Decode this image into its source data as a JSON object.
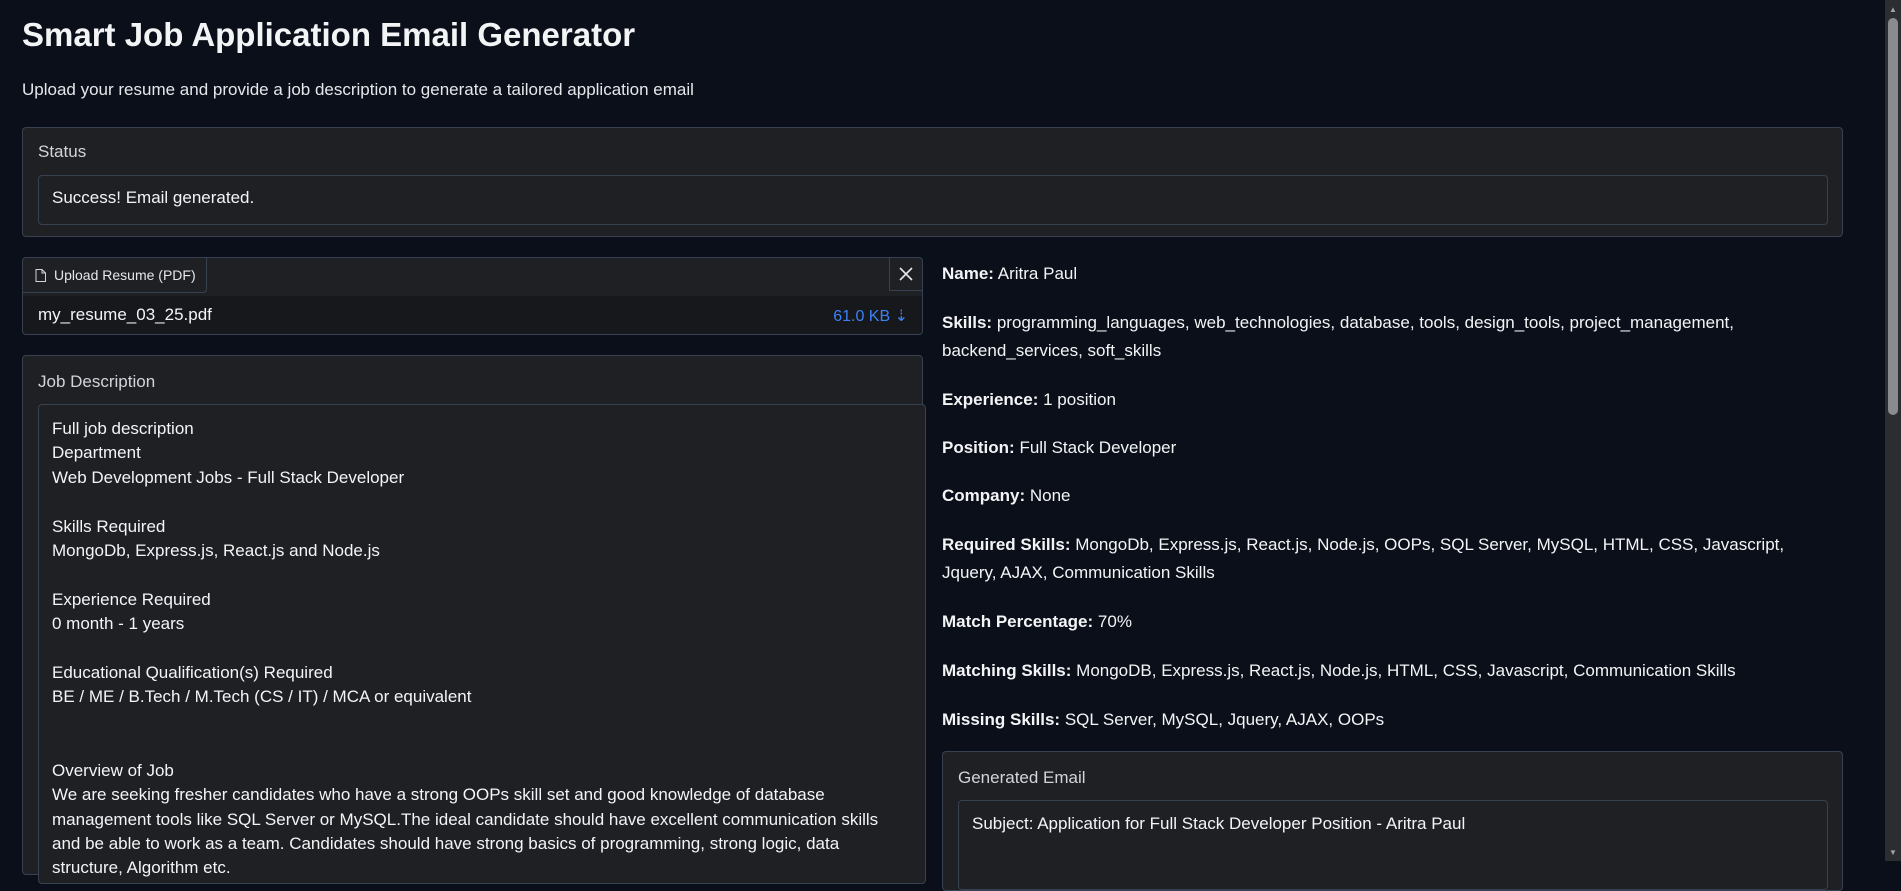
{
  "app": {
    "title": "Smart Job Application Email Generator",
    "subtitle": "Upload your resume and provide a job description to generate a tailored application email"
  },
  "status": {
    "label": "Status",
    "value": "Success! Email generated."
  },
  "upload": {
    "label": "Upload Resume (PDF)",
    "file_name": "my_resume_03_25.pdf",
    "file_size": "61.0 KB ⇣"
  },
  "job_description": {
    "label": "Job Description",
    "value": "Full job description\nDepartment\nWeb Development Jobs - Full Stack Developer\n\nSkills Required\nMongoDb, Express.js, React.js and Node.js\n\nExperience Required\n0 month - 1 years\n\nEducational Qualification(s) Required\nBE / ME / B.Tech / M.Tech (CS / IT) / MCA or equivalent\n\n\nOverview of Job\nWe are seeking fresher candidates who have a strong OOPs skill set and good knowledge of database management tools like SQL Server or MySQL.The ideal candidate should have excellent communication skills and be able to work as a team. Candidates should have strong basics of programming, strong logic, data structure, Algorithm etc."
  },
  "analysis": {
    "name": {
      "label": "Name:",
      "value": "Aritra Paul"
    },
    "skills": {
      "label": "Skills:",
      "value": "programming_languages, web_technologies, database, tools, design_tools, project_management, backend_services, soft_skills"
    },
    "experience": {
      "label": "Experience:",
      "value": "1 position"
    },
    "position": {
      "label": "Position:",
      "value": "Full Stack Developer"
    },
    "company": {
      "label": "Company:",
      "value": "None"
    },
    "required_skills": {
      "label": "Required Skills:",
      "value": "MongoDb, Express.js, React.js, Node.js, OOPs, SQL Server, MySQL, HTML, CSS, Javascript, Jquery, AJAX, Communication Skills"
    },
    "match_percentage": {
      "label": "Match Percentage:",
      "value": "70%"
    },
    "matching_skills": {
      "label": "Matching Skills:",
      "value": "MongoDB, Express.js, React.js, Node.js, HTML, CSS, Javascript, Communication Skills"
    },
    "missing_skills": {
      "label": "Missing Skills:",
      "value": "SQL Server, MySQL, Jquery, AJAX, OOPs"
    }
  },
  "generated_email": {
    "label": "Generated Email",
    "value": "Subject: Application for Full Stack Developer Position - Aritra Paul"
  },
  "colors": {
    "background": "#0b0f19",
    "panel": "#1f2023",
    "border": "#374151",
    "accent": "#3b82f6"
  }
}
